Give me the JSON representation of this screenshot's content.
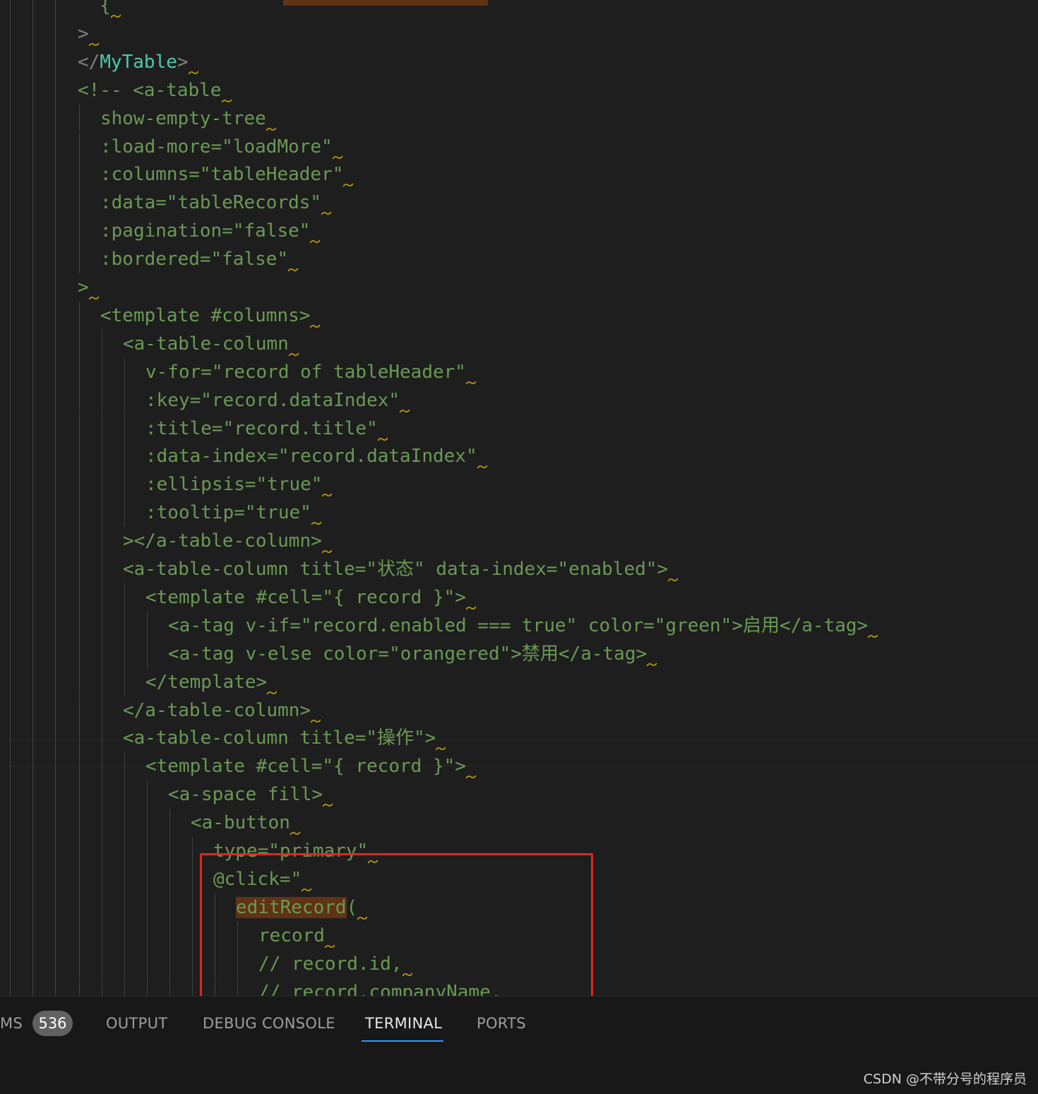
{
  "editor": {
    "lines": [
      {
        "text": "  {",
        "indent": 0,
        "kind": "comment"
      },
      {
        "text": ">",
        "indent": 0,
        "kind": "normal"
      },
      {
        "text": "</MyTable>",
        "indent": 0,
        "kind": "closing-tag"
      },
      {
        "text": "<!-- <a-table",
        "indent": 0,
        "kind": "comment"
      },
      {
        "text": "show-empty-tree",
        "indent": 1,
        "kind": "comment"
      },
      {
        "text": ":load-more=\"loadMore\"",
        "indent": 1,
        "kind": "comment"
      },
      {
        "text": ":columns=\"tableHeader\"",
        "indent": 1,
        "kind": "comment"
      },
      {
        "text": ":data=\"tableRecords\"",
        "indent": 1,
        "kind": "comment"
      },
      {
        "text": ":pagination=\"false\"",
        "indent": 1,
        "kind": "comment"
      },
      {
        "text": ":bordered=\"false\"",
        "indent": 1,
        "kind": "comment"
      },
      {
        "text": ">",
        "indent": 0,
        "kind": "comment"
      },
      {
        "text": "<template #columns>",
        "indent": 1,
        "kind": "comment"
      },
      {
        "text": "<a-table-column",
        "indent": 2,
        "kind": "comment"
      },
      {
        "text": "v-for=\"record of tableHeader\"",
        "indent": 3,
        "kind": "comment"
      },
      {
        "text": ":key=\"record.dataIndex\"",
        "indent": 3,
        "kind": "comment"
      },
      {
        "text": ":title=\"record.title\"",
        "indent": 3,
        "kind": "comment"
      },
      {
        "text": ":data-index=\"record.dataIndex\"",
        "indent": 3,
        "kind": "comment"
      },
      {
        "text": ":ellipsis=\"true\"",
        "indent": 3,
        "kind": "comment"
      },
      {
        "text": ":tooltip=\"true\"",
        "indent": 3,
        "kind": "comment"
      },
      {
        "text": "></a-table-column>",
        "indent": 2,
        "kind": "comment"
      },
      {
        "text": "<a-table-column title=\"状态\" data-index=\"enabled\">",
        "indent": 2,
        "kind": "comment"
      },
      {
        "text": "<template #cell=\"{ record }\">",
        "indent": 3,
        "kind": "comment"
      },
      {
        "text": "<a-tag v-if=\"record.enabled === true\" color=\"green\">启用</a-tag>",
        "indent": 4,
        "kind": "comment"
      },
      {
        "text": "<a-tag v-else color=\"orangered\">禁用</a-tag>",
        "indent": 4,
        "kind": "comment"
      },
      {
        "text": "</template>",
        "indent": 3,
        "kind": "comment"
      },
      {
        "text": "</a-table-column>",
        "indent": 2,
        "kind": "comment"
      },
      {
        "text": "<a-table-column title=\"操作\">",
        "indent": 2,
        "kind": "comment"
      },
      {
        "text": "<template #cell=\"{ record }\">",
        "indent": 3,
        "kind": "comment"
      },
      {
        "text": "<a-space fill>",
        "indent": 4,
        "kind": "comment"
      },
      {
        "text": "<a-button",
        "indent": 5,
        "kind": "comment"
      },
      {
        "text": "type=\"primary\"",
        "indent": 6,
        "kind": "comment"
      },
      {
        "text": "@click=\"",
        "indent": 6,
        "kind": "comment"
      },
      {
        "text": "editRecord(",
        "indent": 7,
        "kind": "comment",
        "highlight": "editRecord"
      },
      {
        "text": "record",
        "indent": 8,
        "kind": "comment"
      },
      {
        "text": "// record.id,",
        "indent": 8,
        "kind": "comment"
      },
      {
        "text": "// record.companyName,",
        "indent": 8,
        "kind": "comment"
      }
    ]
  },
  "panel": {
    "tabs": [
      {
        "label": "MS",
        "active": false
      },
      {
        "label": "OUTPUT",
        "active": false
      },
      {
        "label": "DEBUG CONSOLE",
        "active": false
      },
      {
        "label": "TERMINAL",
        "active": true
      },
      {
        "label": "PORTS",
        "active": false
      }
    ],
    "problems_count": "536"
  },
  "watermark": "CSDN @不带分号的程序员",
  "colors": {
    "background": "#1e1e1e",
    "comment": "#6a9955",
    "tag_name": "#4ec9b0",
    "punctuation": "#808080",
    "match_highlight": "#613214",
    "annotation_box": "#e8231c",
    "active_tab_underline": "#3794ff"
  }
}
